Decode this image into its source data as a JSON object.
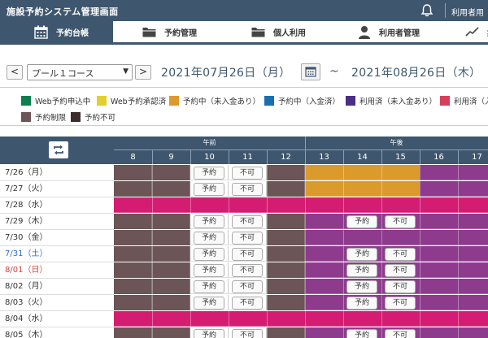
{
  "app": {
    "title": "施設予約システム管理画面",
    "user_link": "利用者用"
  },
  "nav": {
    "tabs": [
      "予約台帳",
      "予約管理",
      "個人利用",
      "利用者管理",
      "集"
    ]
  },
  "toolbar": {
    "prev": "<",
    "next": ">",
    "facility": "プール１コース",
    "caret": "▼",
    "date_from": "2021年07月26日（月）",
    "tilde": "~",
    "date_to": "2021年08月26日（木）"
  },
  "legend": [
    {
      "label": "Web予約申込中",
      "color": "#0d7f4f"
    },
    {
      "label": "Web予約承認済",
      "color": "#e2cf2c"
    },
    {
      "label": "予約中（未入金あり）",
      "color": "#db9a2c"
    },
    {
      "label": "予約中（入金済）",
      "color": "#1a6fb0"
    },
    {
      "label": "利用済（未入金あり）",
      "color": "#4b2f86"
    },
    {
      "label": "利用済（入",
      "color": "#d4405b"
    },
    {
      "label": "予約制限",
      "color": "#6c5557"
    },
    {
      "label": "予約不可",
      "color": "#3b2d2e"
    }
  ],
  "grid": {
    "groups": [
      "午前",
      "午後"
    ],
    "hours": [
      "8",
      "9",
      "10",
      "11",
      "12",
      "13",
      "14",
      "15",
      "16",
      "17"
    ],
    "rows": [
      {
        "date": "7/26（月）",
        "type": "A",
        "day": "wd"
      },
      {
        "date": "7/27（火）",
        "type": "A",
        "day": "wd"
      },
      {
        "date": "7/28（水）",
        "type": "C",
        "day": "wd"
      },
      {
        "date": "7/29（木）",
        "type": "B",
        "day": "wd"
      },
      {
        "date": "7/30（金）",
        "type": "D",
        "day": "wd"
      },
      {
        "date": "7/31（土）",
        "type": "B",
        "day": "sat"
      },
      {
        "date": "8/01（日）",
        "type": "B",
        "day": "sun"
      },
      {
        "date": "8/02（月）",
        "type": "B",
        "day": "wd"
      },
      {
        "date": "8/03（火）",
        "type": "B",
        "day": "wd"
      },
      {
        "date": "8/04（水）",
        "type": "C",
        "day": "wd"
      },
      {
        "date": "8/05（木）",
        "type": "B",
        "day": "wd"
      }
    ],
    "reserve_label": "予約",
    "disable_label": "不可",
    "colors": {
      "orange": "#db9a2c",
      "purple": "#8e3b8e",
      "pink": "#d41d72",
      "gray": "#6c5557"
    }
  }
}
